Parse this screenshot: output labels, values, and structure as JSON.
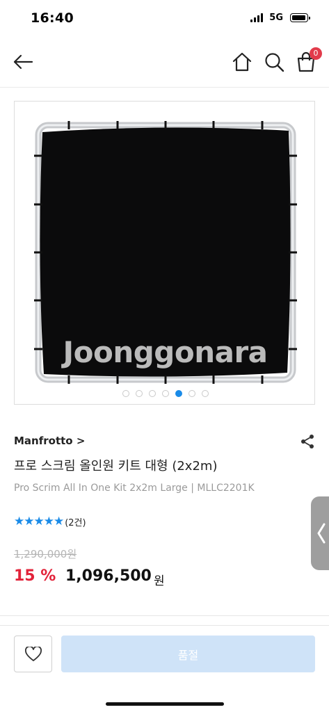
{
  "status_bar": {
    "time": "16:40",
    "network": "5G"
  },
  "header": {
    "cart_count": "0"
  },
  "gallery": {
    "watermark": "Joonggonara",
    "slide_count": 7,
    "active_index": 4
  },
  "product": {
    "brand": "Manfrotto >",
    "title_ko": "프로 스크림 올인원 키트 대형 (2x2m)",
    "title_en": "Pro Scrim All In One Kit 2x2m Large | MLLC2201K",
    "rating_stars": "★★★★★",
    "review_count": "(2건)",
    "original_price": "1,290,000원",
    "discount": "15 %",
    "price": "1,096,500",
    "currency": "원"
  },
  "bottom_bar": {
    "soldout_label": "품절"
  },
  "colors": {
    "accent": "#1a8be8",
    "discount": "#e2233a",
    "badge": "#e23b4b",
    "soldout_button": "#cfe3f8"
  },
  "icons": [
    "back-arrow-icon",
    "home-icon",
    "search-icon",
    "cart-icon",
    "share-icon",
    "heart-icon",
    "chevron-left-icon"
  ]
}
